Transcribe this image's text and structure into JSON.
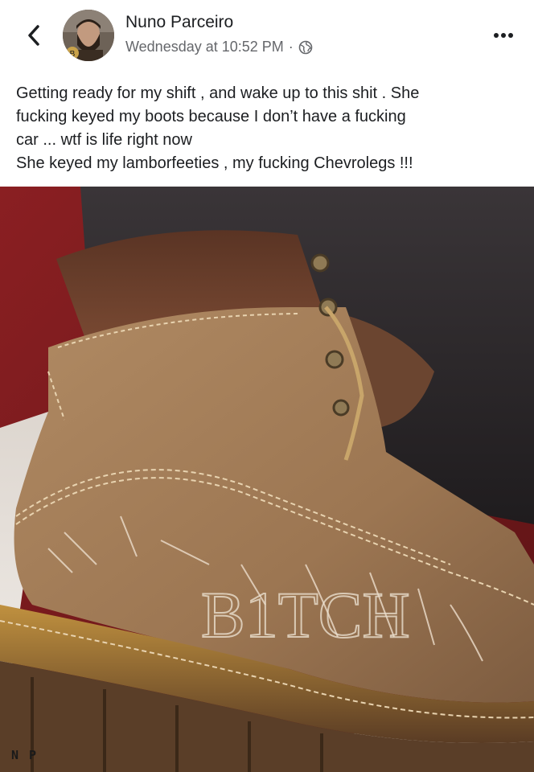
{
  "header": {
    "author_name": "Nuno Parceiro",
    "timestamp": "Wednesday at 10:52 PM",
    "separator": "·",
    "privacy_icon": "globe-icon",
    "back_icon": "chevron-left-icon",
    "more_icon": "more-horizontal-icon"
  },
  "post": {
    "lines": [
      "Getting ready for my shift , and wake up to this shit . She",
      "fucking keyed my boots because I don’t have a fucking",
      "car ... wtf is life right now",
      "She keyed my lamborfeeties , my fucking Chevrolegs !!!"
    ]
  },
  "photo": {
    "watermark": "N P",
    "scratched_text": "B1TCH"
  },
  "colors": {
    "text": "#1c1e21",
    "secondary": "#65676b",
    "boot": "#a7805a",
    "sole": "#6b4b33"
  }
}
